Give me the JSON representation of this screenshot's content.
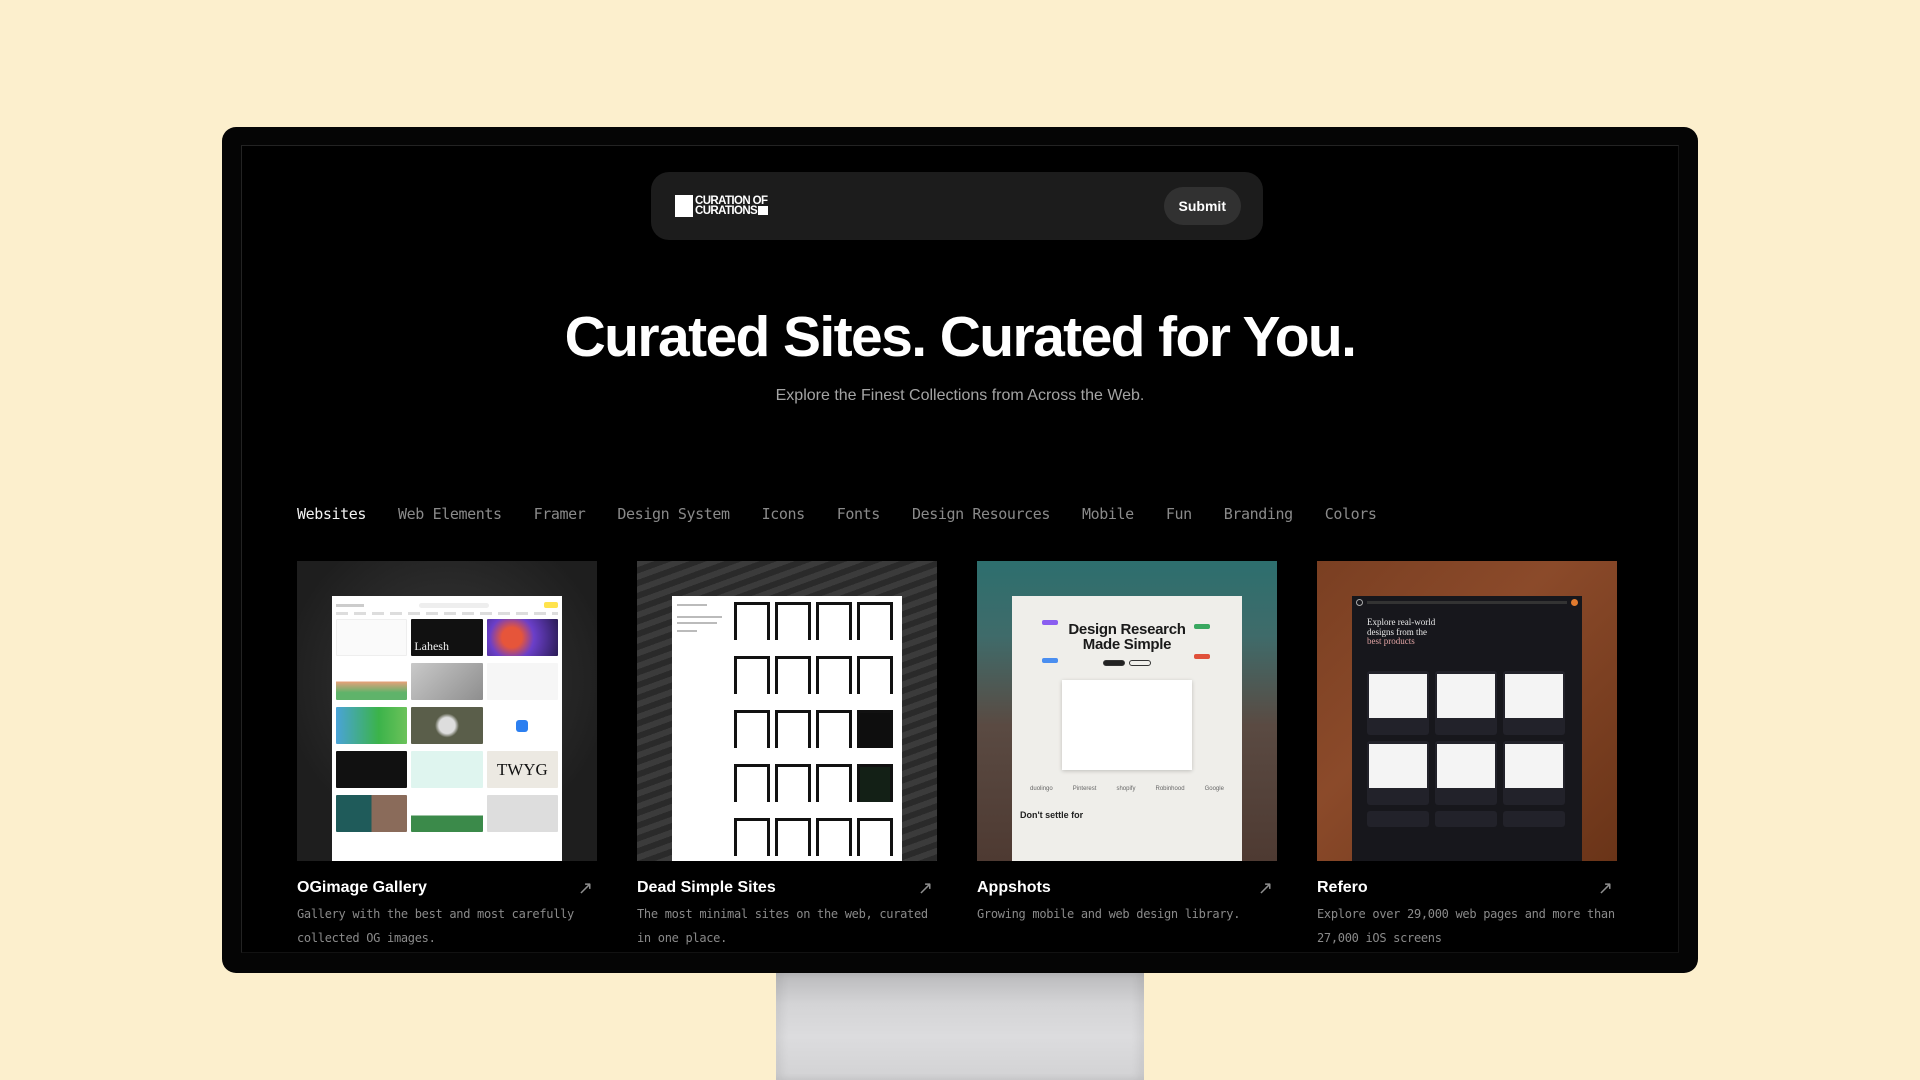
{
  "header": {
    "logo_line1": "CURATION OF",
    "logo_line2": "CURATIONS",
    "submit_label": "Submit"
  },
  "hero": {
    "title": "Curated Sites. Curated for You.",
    "subtitle": "Explore the Finest Collections from Across the Web."
  },
  "tabs": [
    {
      "label": "Websites",
      "active": true
    },
    {
      "label": "Web Elements",
      "active": false
    },
    {
      "label": "Framer",
      "active": false
    },
    {
      "label": "Design System",
      "active": false
    },
    {
      "label": "Icons",
      "active": false
    },
    {
      "label": "Fonts",
      "active": false
    },
    {
      "label": "Design Resources",
      "active": false
    },
    {
      "label": "Mobile",
      "active": false
    },
    {
      "label": "Fun",
      "active": false
    },
    {
      "label": "Branding",
      "active": false
    },
    {
      "label": "Colors",
      "active": false
    }
  ],
  "cards": [
    {
      "title": "OGimage Gallery",
      "description": "Gallery with the best and most carefully collected OG images.",
      "icon": "arrow-up-right-icon",
      "thumb_text": [
        "Lahesh",
        "TWYG"
      ]
    },
    {
      "title": "Dead Simple Sites",
      "description": "The most minimal sites on the web, curated in one place.",
      "icon": "arrow-up-right-icon"
    },
    {
      "title": "Appshots",
      "description": "Growing mobile and web design library.",
      "icon": "arrow-up-right-icon",
      "thumb_text": [
        "Design Research",
        "Made Simple",
        "Don't settle for"
      ],
      "thumb_logos": [
        "duolingo",
        "Pinterest",
        "shopify",
        "Robinhood",
        "Google"
      ]
    },
    {
      "title": "Refero",
      "description": "Explore over 29,000 web pages and more than 27,000 iOS screens",
      "icon": "arrow-up-right-icon",
      "thumb_text": [
        "Explore real-world",
        "designs from the",
        "best products"
      ]
    }
  ],
  "colors": {
    "page_background": "#fcefcd",
    "screen_background": "#000000",
    "header_background": "#1c1c1c",
    "tab_active": "#f2f2f2",
    "tab_inactive": "#8a8a8a"
  }
}
